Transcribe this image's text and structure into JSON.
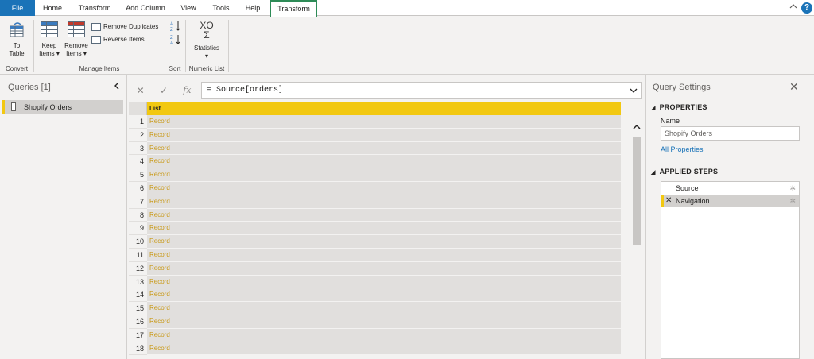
{
  "tabs": [
    "File",
    "Home",
    "Transform",
    "Add Column",
    "View",
    "Tools",
    "Help",
    "Transform"
  ],
  "window_controls": {
    "collapse": "^",
    "help": "?"
  },
  "ribbon": {
    "to_table": "To\nTable",
    "to_table_l1": "To",
    "to_table_l2": "Table",
    "keep_items": "Keep",
    "keep_items_l2": "Items",
    "remove_items": "Remove",
    "remove_items_l2": "Items",
    "remove_duplicates": "Remove Duplicates",
    "reverse_items": "Reverse Items",
    "statistics": "Statistics",
    "stat_symbols": "XΟ",
    "sigma": "Σ",
    "groups": {
      "convert": "Convert",
      "manage_items": "Manage Items",
      "sort": "Sort",
      "numeric_list": "Numeric List"
    }
  },
  "queries": {
    "title": "Queries [1]",
    "items": [
      "Shopify Orders"
    ]
  },
  "formula": {
    "cancel": "✕",
    "commit": "✓",
    "fx": "fx",
    "value": "= Source[orders]"
  },
  "grid": {
    "column_header": "List",
    "rows": [
      {
        "n": "1",
        "v": "Record"
      },
      {
        "n": "2",
        "v": "Record"
      },
      {
        "n": "3",
        "v": "Record"
      },
      {
        "n": "4",
        "v": "Record"
      },
      {
        "n": "5",
        "v": "Record"
      },
      {
        "n": "6",
        "v": "Record"
      },
      {
        "n": "7",
        "v": "Record"
      },
      {
        "n": "8",
        "v": "Record"
      },
      {
        "n": "9",
        "v": "Record"
      },
      {
        "n": "10",
        "v": "Record"
      },
      {
        "n": "11",
        "v": "Record"
      },
      {
        "n": "12",
        "v": "Record"
      },
      {
        "n": "13",
        "v": "Record"
      },
      {
        "n": "14",
        "v": "Record"
      },
      {
        "n": "15",
        "v": "Record"
      },
      {
        "n": "16",
        "v": "Record"
      },
      {
        "n": "17",
        "v": "Record"
      },
      {
        "n": "18",
        "v": "Record"
      }
    ]
  },
  "settings": {
    "title": "Query Settings",
    "close": "✕",
    "properties": "PROPERTIES",
    "name_label": "Name",
    "name_value": "Shopify Orders",
    "all_properties": "All Properties",
    "applied_steps": "APPLIED STEPS",
    "steps": [
      {
        "label": "Source",
        "selected": false
      },
      {
        "label": "Navigation",
        "selected": true
      }
    ]
  },
  "colors": {
    "file_tab": "#1a73b8",
    "accent": "#f2c811",
    "active_tab_border": "#2e8b57",
    "record_text": "#c99a19"
  }
}
